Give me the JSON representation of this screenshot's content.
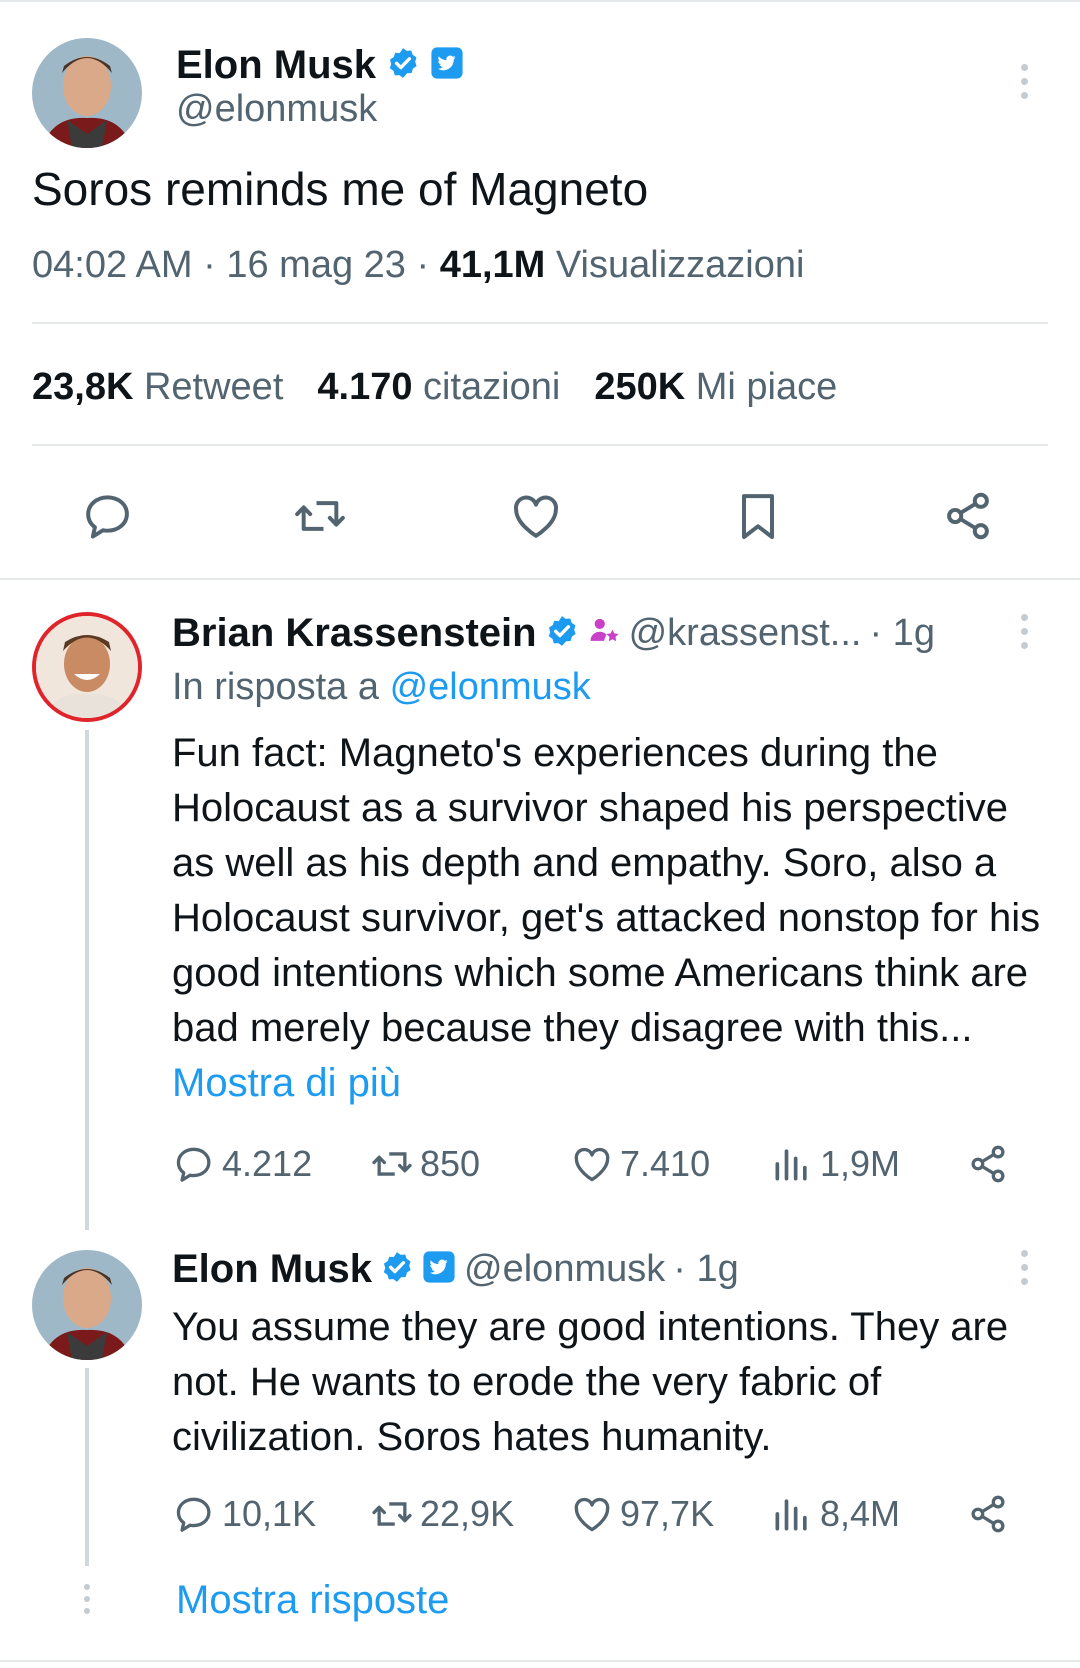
{
  "main_tweet": {
    "author_name": "Elon Musk",
    "author_handle": "@elonmusk",
    "text": "Soros reminds me of Magneto",
    "time": "04:02 AM",
    "sep1": "·",
    "date": "16 mag 23",
    "sep2": "·",
    "views_count": "41,1M",
    "views_label": "Visualizzazioni",
    "stats": {
      "retweets_count": "23,8K",
      "retweets_label": "Retweet",
      "quotes_count": "4.170",
      "quotes_label": "citazioni",
      "likes_count": "250K",
      "likes_label": "Mi piace"
    },
    "actions": [
      "reply-icon",
      "retweet-icon",
      "like-icon",
      "bookmark-icon",
      "share-icon"
    ]
  },
  "reply1": {
    "author_name": "Brian Krassenstein",
    "author_handle": "@krassenst...",
    "age": "· 1g",
    "in_reply_prefix": "In risposta a",
    "in_reply_handle": "@elonmusk",
    "text": "Fun fact:  Magneto's experiences during the Holocaust as a survivor shaped his perspective as well as his depth and empathy. Soro, also a Holocaust survivor, get's attacked nonstop for his good intentions which some Americans think are bad merely because they disagree with this...",
    "show_more": "Mostra di più",
    "replies": "4.212",
    "retweets": "850",
    "likes": "7.410",
    "views": "1,9M"
  },
  "reply2": {
    "author_name": "Elon Musk",
    "author_handle": "@elonmusk",
    "age": "· 1g",
    "text": "You assume they are good intentions. They are not. He wants to erode the very fabric of civilization. Soros hates humanity.",
    "replies": "10,1K",
    "retweets": "22,9K",
    "likes": "97,7K",
    "views": "8,4M"
  },
  "show_replies": "Mostra risposte",
  "colors": {
    "accent": "#1d9bf0",
    "text": "#0f1419",
    "muted": "#536471",
    "divider": "#e6e9ec"
  }
}
